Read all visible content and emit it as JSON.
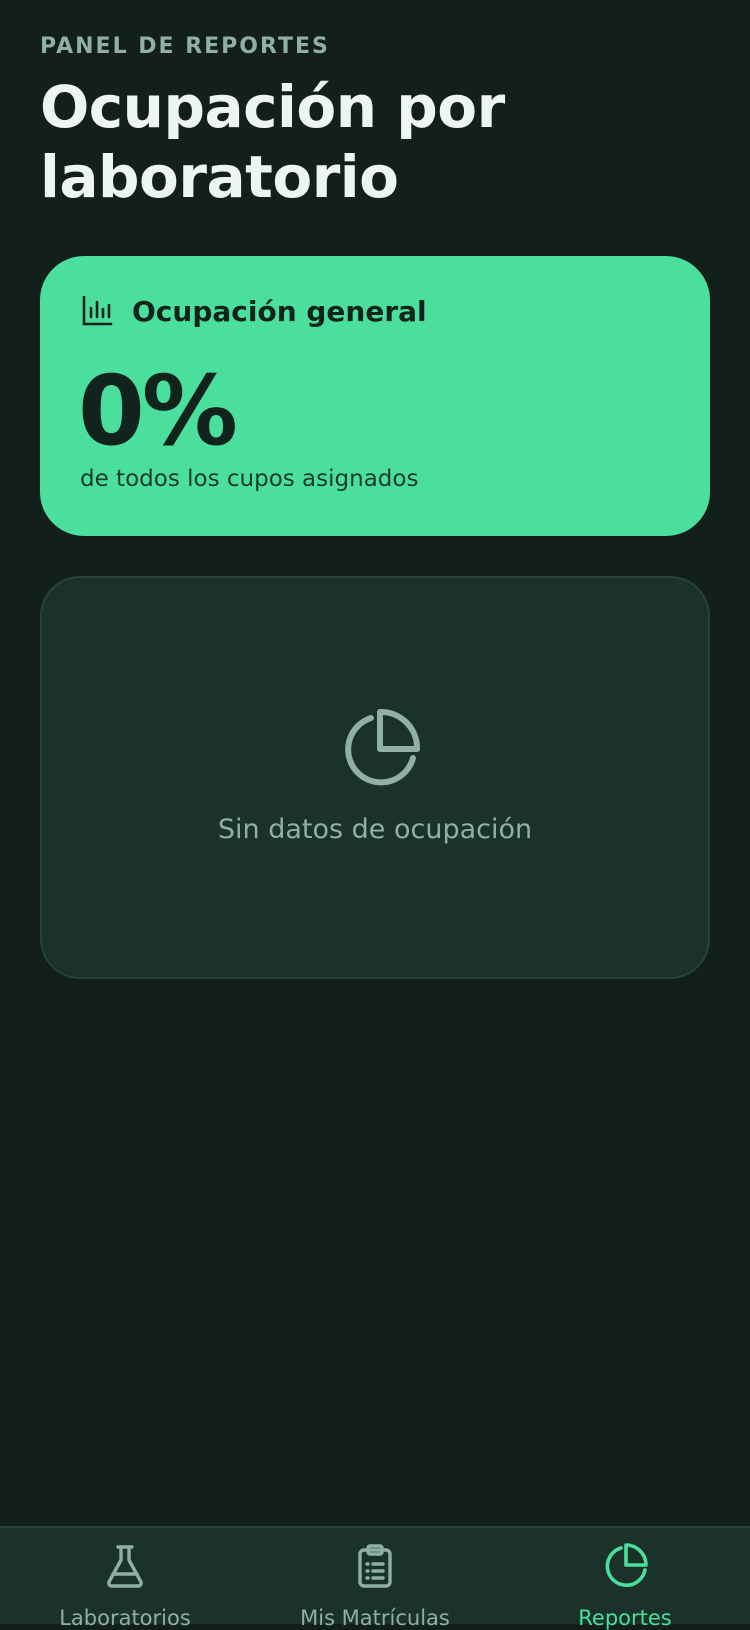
{
  "header": {
    "eyebrow": "PANEL DE REPORTES",
    "title": "Ocupación por laboratorio"
  },
  "summary": {
    "title": "Ocupación general",
    "value": "0%",
    "value_fraction": 0,
    "caption": "de todos los cupos asignados",
    "icon": "bar-chart-icon"
  },
  "empty_state": {
    "icon": "pie-chart-icon",
    "message": "Sin datos de ocupación"
  },
  "nav": {
    "items": [
      {
        "label": "Laboratorios",
        "icon": "flask-icon",
        "active": false
      },
      {
        "label": "Mis Matrículas",
        "icon": "clipboard-icon",
        "active": false
      },
      {
        "label": "Reportes",
        "icon": "pie-chart-icon",
        "active": true
      }
    ]
  },
  "colors": {
    "background": "#121f1b",
    "accent": "#4adf9d",
    "card": "#1b322b",
    "muted_text": "#8fb0a3",
    "primary_text": "#eef5f1"
  }
}
